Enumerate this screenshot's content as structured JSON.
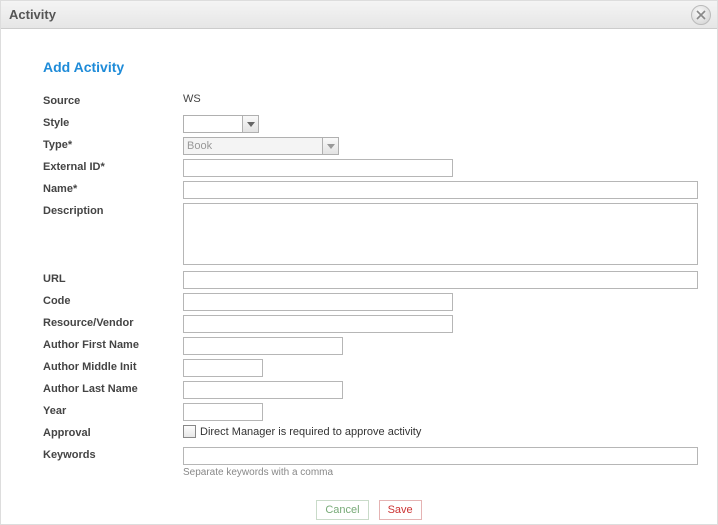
{
  "dialog": {
    "title": "Activity"
  },
  "heading": "Add Activity",
  "labels": {
    "source": "Source",
    "style": "Style",
    "type": "Type*",
    "external_id": "External ID*",
    "name": "Name*",
    "description": "Description",
    "url": "URL",
    "code": "Code",
    "resource_vendor": "Resource/Vendor",
    "author_first": "Author First Name",
    "author_middle": "Author Middle Init",
    "author_last": "Author Last Name",
    "year": "Year",
    "approval": "Approval",
    "keywords": "Keywords"
  },
  "values": {
    "source": "WS",
    "style": "",
    "type": "Book",
    "external_id": "",
    "name": "",
    "description": "",
    "url": "",
    "code": "",
    "resource_vendor": "",
    "author_first": "",
    "author_middle": "",
    "author_last": "",
    "year": "",
    "approval_checked": false,
    "approval_label": "Direct Manager is required to approve activity",
    "keywords": ""
  },
  "helper": {
    "keywords": "Separate keywords with a comma"
  },
  "buttons": {
    "cancel": "Cancel",
    "save": "Save"
  }
}
